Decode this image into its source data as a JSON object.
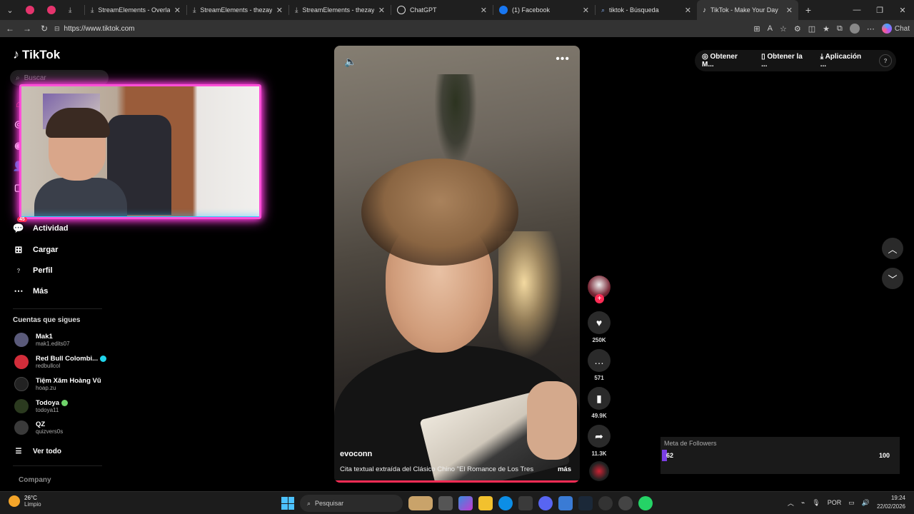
{
  "browser": {
    "tabs": [
      {
        "title": "",
        "icon": "pink-dot",
        "color": "#e5346d"
      },
      {
        "title": "",
        "icon": "red-dot",
        "color": "#e5346d"
      },
      {
        "title": "",
        "icon": "download",
        "color": "#bbbbbb"
      },
      {
        "title": "StreamElements - Overlays",
        "icon": "streamelements",
        "color": "#bbbbbb"
      },
      {
        "title": "StreamElements - thezaya",
        "icon": "streamelements",
        "color": "#bbbbbb"
      },
      {
        "title": "StreamElements - thezaya",
        "icon": "streamelements",
        "color": "#bbbbbb"
      },
      {
        "title": "ChatGPT",
        "icon": "chatgpt",
        "color": "#dddddd"
      },
      {
        "title": "(1) Facebook",
        "icon": "facebook",
        "color": "#1877f2"
      },
      {
        "title": "tiktok - Búsqueda",
        "icon": "search",
        "color": "#8ab4f8"
      },
      {
        "title": "TikTok - Make Your Day",
        "icon": "tiktok",
        "color": "#ffffff",
        "active": true
      }
    ],
    "url": "https://www.tiktok.com",
    "chat_label": "Chat"
  },
  "tiktok": {
    "logo_text": "TikTok",
    "search_placeholder": "Buscar",
    "nav": {
      "actividad": "Actividad",
      "actividad_badge": "45",
      "cargar": "Cargar",
      "perfil": "Perfil",
      "mas": "Más"
    },
    "following_title": "Cuentas que sigues",
    "following": [
      {
        "name": "Mak1",
        "handle": "mak1.edits07",
        "color": "#5a5a7a"
      },
      {
        "name": "Red Bull Colombi...",
        "handle": "redbullcol",
        "color": "#d22d3a",
        "verified": true
      },
      {
        "name": "Tiệm Xăm Hoàng Vũ",
        "handle": "hoap.zu",
        "color": "#222222"
      },
      {
        "name": "Todoya",
        "handle": "todoya11",
        "color": "#2b3a1f",
        "alien": true
      },
      {
        "name": "QZ",
        "handle": "quizvers0s",
        "color": "#3a3a3a"
      }
    ],
    "ver_todo": "Ver todo",
    "company": "Company",
    "top_right": {
      "btn1": "Obtener M...",
      "btn2": "Obtener la ...",
      "btn3": "Aplicación ...",
      "help": "?"
    },
    "video": {
      "username": "evoconn",
      "caption": "Cita textual extraída del Clásico Chino \"El Romance de Los Tres",
      "more": "más",
      "likes": "250K",
      "comments": "571",
      "saves": "49.9K",
      "shares": "11.3K"
    }
  },
  "overlay": {
    "goal_title": "Meta de Followers",
    "goal_current": "62",
    "goal_max": "100",
    "goal_fraction": 0.62,
    "goal_color": "#7b3fe4"
  },
  "taskbar": {
    "weather_temp": "26°C",
    "weather_desc": "Limpio",
    "search_label": "Pesquisar",
    "lang": "POR",
    "time": "19:24",
    "date": "22/02/2026"
  }
}
